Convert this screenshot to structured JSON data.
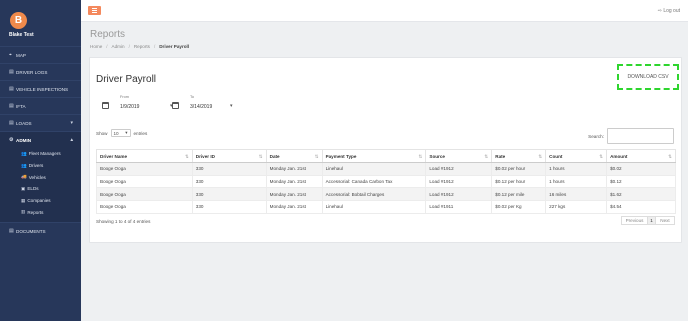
{
  "user": {
    "initial": "B",
    "name": "Blake Test"
  },
  "sidebar": {
    "items": [
      {
        "icon": "⌖",
        "label": "MAP"
      },
      {
        "icon": "▤",
        "label": "DRIVER LOGS"
      },
      {
        "icon": "▤",
        "label": "VEHICLE INSPECTIONS"
      },
      {
        "icon": "▤",
        "label": "IFTA"
      },
      {
        "icon": "▤",
        "label": "LOADS",
        "caret": "▾"
      },
      {
        "icon": "⚙",
        "label": "ADMIN",
        "caret": "▴"
      }
    ],
    "admin_sub": [
      {
        "icon": "👥",
        "label": "Fleet Managers"
      },
      {
        "icon": "👥",
        "label": "Drivers"
      },
      {
        "icon": "🚚",
        "label": "Vehicles"
      },
      {
        "icon": "▣",
        "label": "ELDs"
      },
      {
        "icon": "▦",
        "label": "Companies"
      },
      {
        "icon": "▥",
        "label": "Reports"
      }
    ],
    "documents": {
      "icon": "▤",
      "label": "DOCUMENTS"
    }
  },
  "topbar": {
    "logout": "⇨ Log out"
  },
  "page": {
    "title": "Reports",
    "breadcrumb": [
      "Home",
      "Admin",
      "Reports",
      "Driver Payroll"
    ],
    "sep": "/"
  },
  "card": {
    "title": "Driver Payroll",
    "download_csv": "DOWNLOAD CSV",
    "from_label": "From",
    "from_value": "1/9/2019",
    "to_label": "To",
    "to_value": "3/14/2019",
    "show_label": "Show",
    "show_value": "10",
    "entries_label": "entries",
    "search_label": "Search:",
    "info": "Showing 1 to 4 of 4 entries",
    "prev": "Previous",
    "page": "1",
    "next": "Next"
  },
  "table": {
    "headers": [
      "Driver Name",
      "Driver ID",
      "Date",
      "Payment Type",
      "Source",
      "Rate",
      "Count",
      "Amount"
    ],
    "rows": [
      [
        "Booge Ooga",
        "330",
        "Monday Jan. 21st",
        "Linehaul",
        "Load #1912",
        "$0.02 per hour",
        "1 hours",
        "$0.02"
      ],
      [
        "Booge Ooga",
        "330",
        "Monday Jan. 21st",
        "Accessorial: Canada Carbon Tax",
        "Load #1912",
        "$0.12 per hour",
        "1 hours",
        "$0.12"
      ],
      [
        "Booge Ooga",
        "330",
        "Monday Jan. 21st",
        "Accessorial: Bobtail Charges",
        "Load #1912",
        "$0.12 per mile",
        "16 miles",
        "$1.62"
      ],
      [
        "Booge Ooga",
        "330",
        "Monday Jan. 21st",
        "Linehaul",
        "Load #1911",
        "$0.02 per Kg",
        "227 kgs",
        "$4.54"
      ]
    ]
  },
  "colors": {
    "sidebar": "#27375a",
    "accent": "#f4895d",
    "highlight": "#2ed52e"
  }
}
